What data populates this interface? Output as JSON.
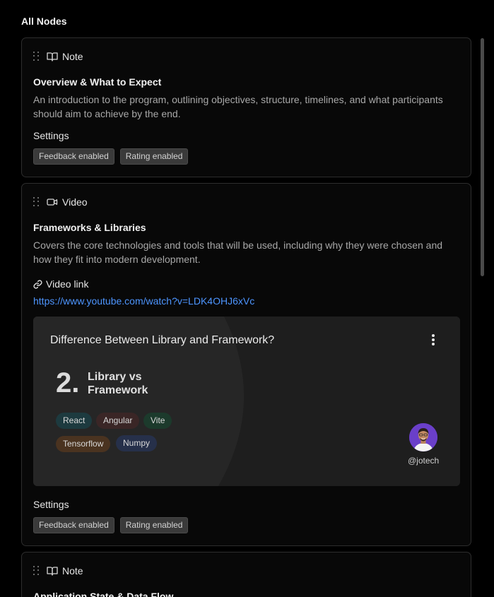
{
  "section_title": "All Nodes",
  "nodes": [
    {
      "type_label": "Note",
      "type_icon": "book-open-icon",
      "title": "Overview & What to Expect",
      "description": "An introduction to the program, outlining objectives, structure, timelines, and what participants should aim to achieve by the end.",
      "settings_label": "Settings",
      "badges": [
        "Feedback enabled",
        "Rating enabled"
      ]
    },
    {
      "type_label": "Video",
      "type_icon": "video-camera-icon",
      "title": "Frameworks & Libraries",
      "description": "Covers the core technologies and tools that will be used, including why they were chosen and how they fit into modern development.",
      "video_link_label": "Video link",
      "video_url": "https://www.youtube.com/watch?v=LDK4OHJ6xVc",
      "thumbnail": {
        "title": "Difference Between Library and Framework?",
        "number": "2.",
        "chapter_title": "Library vs Framework",
        "tags": [
          {
            "label": "React",
            "color": "#1d3a3f"
          },
          {
            "label": "Angular",
            "color": "#3a2626"
          },
          {
            "label": "Vite",
            "color": "#1c3a2c"
          },
          {
            "label": "Tensorflow",
            "color": "#4a3320"
          },
          {
            "label": "Numpy",
            "color": "#26304a"
          }
        ],
        "handle": "@jotech"
      },
      "settings_label": "Settings",
      "badges": [
        "Feedback enabled",
        "Rating enabled"
      ]
    },
    {
      "type_label": "Note",
      "type_icon": "book-open-icon",
      "title": "Application State & Data Flow"
    }
  ],
  "colors": {
    "background": "#000000",
    "card_border": "#2d2d2d",
    "link": "#4d95ff",
    "avatar_bg": "#6a3fc9"
  }
}
